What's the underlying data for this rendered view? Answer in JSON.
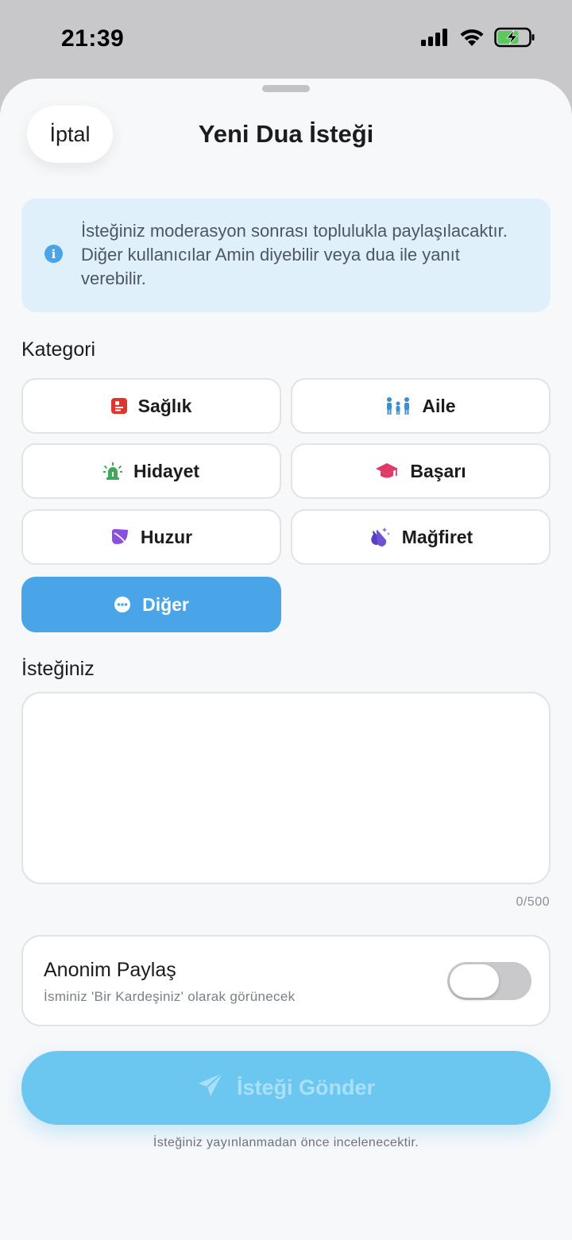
{
  "status_bar": {
    "time": "21:39",
    "icons": [
      "signal-icon",
      "wifi-icon",
      "battery-charging-icon"
    ]
  },
  "header": {
    "cancel_label": "İptal",
    "title": "Yeni Dua İsteği"
  },
  "info": {
    "icon": "info-icon",
    "text": "İsteğiniz moderasyon sonrası toplulukla paylaşılacaktır. Diğer kullanıcılar Amin diyebilir veya dua ile yanıt verebilir."
  },
  "category": {
    "label": "Kategori",
    "items": [
      {
        "label": "Sağlık",
        "icon": "health-card-icon",
        "color": "#e0342f",
        "selected": false
      },
      {
        "label": "Aile",
        "icon": "family-icon",
        "color": "#3a8fd0",
        "selected": false
      },
      {
        "label": "Hidayet",
        "icon": "light-beacon-icon",
        "color": "#3fa85a",
        "selected": false
      },
      {
        "label": "Başarı",
        "icon": "graduation-cap-icon",
        "color": "#e03a6a",
        "selected": false
      },
      {
        "label": "Huzur",
        "icon": "leaf-icon",
        "color": "#8a4fe0",
        "selected": false
      },
      {
        "label": "Mağfiret",
        "icon": "praying-hands-icon",
        "color": "#5a3fc0",
        "selected": false
      },
      {
        "label": "Diğer",
        "icon": "more-dots-icon",
        "color": "#ffffff",
        "selected": true
      }
    ]
  },
  "request": {
    "label": "İsteğiniz",
    "value": "",
    "char_count": "0/500"
  },
  "anonymous": {
    "title": "Anonim Paylaş",
    "subtitle": "İsminiz 'Bir Kardeşiniz' olarak görünecek",
    "enabled": false
  },
  "submit": {
    "label": "İsteği Gönder",
    "icon": "send-paper-plane-icon"
  },
  "footnote": "İsteğiniz yayınlanmadan önce incelenecektir.",
  "colors": {
    "accent": "#4aa5e8",
    "submit_bg": "#6cc7f0",
    "info_bg": "#e0f0fa"
  }
}
